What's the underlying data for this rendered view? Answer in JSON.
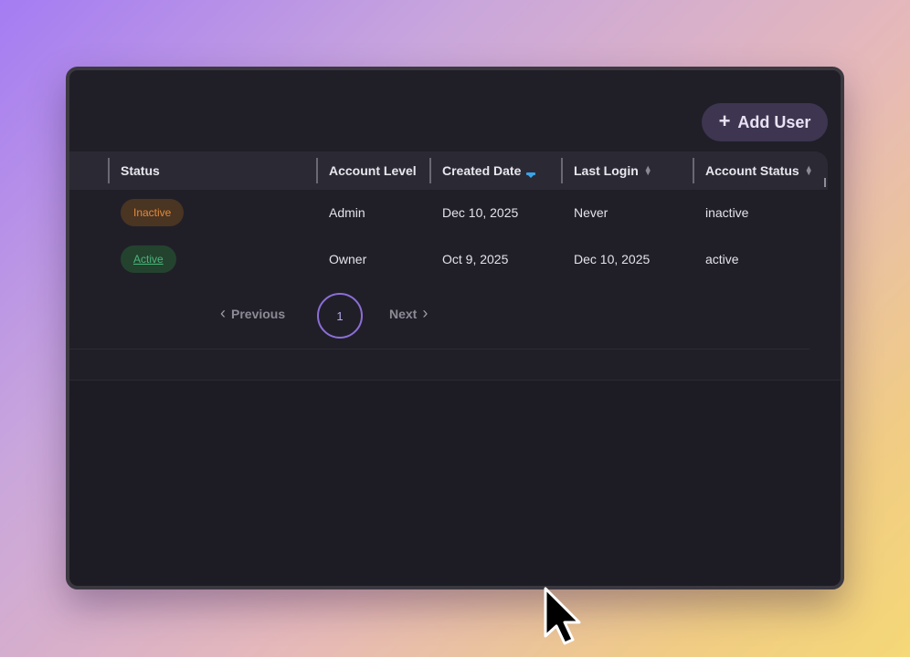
{
  "toolbar": {
    "add_user_label": "Add User",
    "add_icon": "plus-icon"
  },
  "table": {
    "columns": [
      {
        "label": "Status",
        "sort": "none"
      },
      {
        "label": "Account Level",
        "sort": "none"
      },
      {
        "label": "Created Date",
        "sort": "descending"
      },
      {
        "label": "Last Login",
        "sort": "sortable"
      },
      {
        "label": "Account Status",
        "sort": "sortable"
      }
    ],
    "rows": [
      {
        "status": "Inactive",
        "account_level": "Admin",
        "created_date": "Dec 10, 2025",
        "last_login": "Never",
        "account_status": "inactive"
      },
      {
        "status": "Active",
        "account_level": "Owner",
        "created_date": "Oct 9, 2025",
        "last_login": "Dec 10, 2025",
        "account_status": "active"
      }
    ]
  },
  "pagination": {
    "previous_label": "Previous",
    "next_label": "Next",
    "current_page": "1"
  },
  "colors": {
    "accent": "#8c6ed6",
    "inactive_badge_text": "#e08a3a",
    "active_badge_text": "#4ab57a",
    "sort_active": "#3aa4e8"
  }
}
